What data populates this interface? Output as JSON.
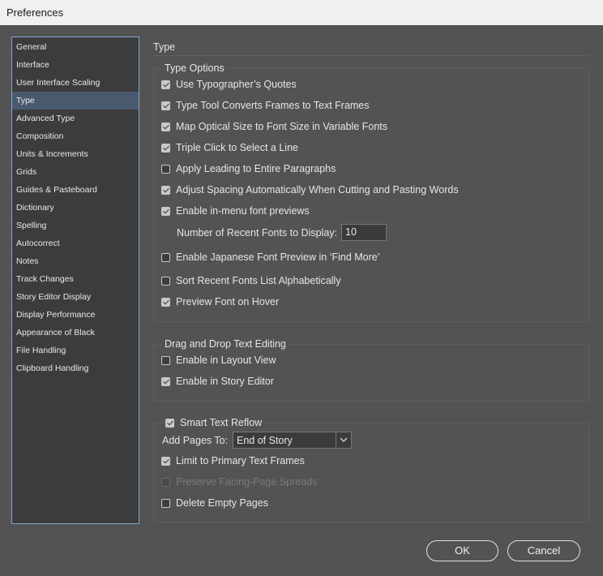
{
  "window": {
    "title": "Preferences"
  },
  "sidebar": {
    "items": [
      {
        "label": "General"
      },
      {
        "label": "Interface"
      },
      {
        "label": "User Interface Scaling"
      },
      {
        "label": "Type"
      },
      {
        "label": "Advanced Type"
      },
      {
        "label": "Composition"
      },
      {
        "label": "Units & Increments"
      },
      {
        "label": "Grids"
      },
      {
        "label": "Guides & Pasteboard"
      },
      {
        "label": "Dictionary"
      },
      {
        "label": "Spelling"
      },
      {
        "label": "Autocorrect"
      },
      {
        "label": "Notes"
      },
      {
        "label": "Track Changes"
      },
      {
        "label": "Story Editor Display"
      },
      {
        "label": "Display Performance"
      },
      {
        "label": "Appearance of Black"
      },
      {
        "label": "File Handling"
      },
      {
        "label": "Clipboard Handling"
      }
    ],
    "selected": "Type"
  },
  "page": {
    "title": "Type"
  },
  "type_options": {
    "label": "Type Options",
    "options": [
      {
        "label": "Use Typographer’s Quotes",
        "checked": true
      },
      {
        "label": "Type Tool Converts Frames to Text Frames",
        "checked": true
      },
      {
        "label": "Map Optical Size to Font Size in Variable Fonts",
        "checked": true
      },
      {
        "label": "Triple Click to Select a Line",
        "checked": true
      },
      {
        "label": "Apply Leading to Entire Paragraphs",
        "checked": false
      },
      {
        "label": "Adjust Spacing Automatically When Cutting and Pasting Words",
        "checked": true
      },
      {
        "label": "Enable in-menu font previews",
        "checked": true
      }
    ],
    "recent_fonts_label": "Number of Recent Fonts to Display:",
    "recent_fonts_value": "10",
    "more_options": [
      {
        "label": "Enable Japanese Font Preview in ‘Find More’",
        "checked": false
      },
      {
        "label": "Sort Recent Fonts List Alphabetically",
        "checked": false
      },
      {
        "label": "Preview Font on Hover",
        "checked": true
      }
    ]
  },
  "drag_drop": {
    "label": "Drag and Drop Text Editing",
    "options": [
      {
        "label": "Enable in Layout View",
        "checked": false
      },
      {
        "label": "Enable in Story Editor",
        "checked": true
      }
    ]
  },
  "smart_reflow": {
    "label": "Smart Text Reflow",
    "checked": true,
    "add_pages_label": "Add Pages To:",
    "add_pages_value": "End of Story",
    "options": [
      {
        "label": "Limit to Primary Text Frames",
        "checked": true,
        "disabled": false
      },
      {
        "label": "Preserve Facing-Page Spreads",
        "checked": false,
        "disabled": true
      },
      {
        "label": "Delete Empty Pages",
        "checked": false,
        "disabled": false
      }
    ]
  },
  "buttons": {
    "ok": "OK",
    "cancel": "Cancel"
  },
  "colors": {
    "dialog_bg": "#535353",
    "sidebar_bg": "#3c3c3c",
    "selection": "#4a5a6e",
    "focus_border": "#7fa6d6"
  }
}
